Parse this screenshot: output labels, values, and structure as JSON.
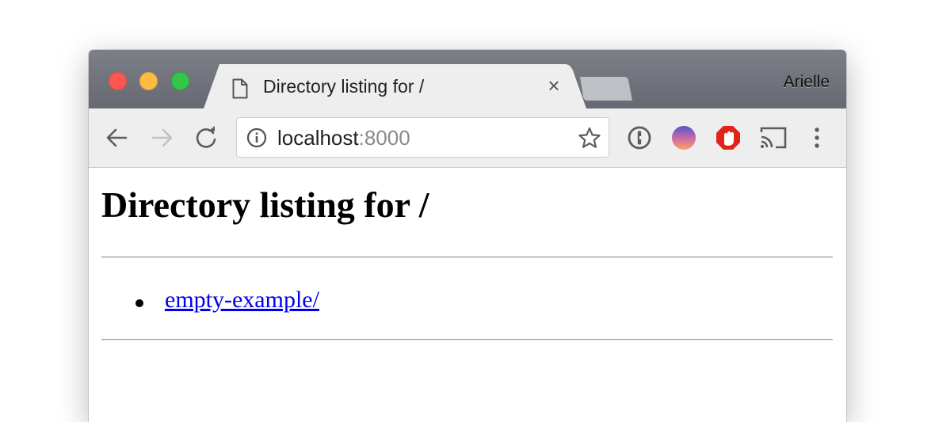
{
  "window": {
    "controls": [
      "close",
      "minimize",
      "zoom"
    ]
  },
  "tab": {
    "title": "Directory listing for /",
    "icon": "document-icon",
    "close_label": "×"
  },
  "profile": {
    "name": "Arielle"
  },
  "toolbar": {
    "back_icon": "back-arrow-icon",
    "forward_icon": "forward-arrow-icon",
    "reload_icon": "reload-icon",
    "url_host": "localhost",
    "url_port": ":8000",
    "info_icon": "info-icon",
    "bookmark_icon": "star-icon",
    "extensions": [
      "1password-icon",
      "gradient-extension-icon",
      "adblock-icon",
      "cast-icon",
      "more-menu-icon"
    ]
  },
  "page": {
    "heading": "Directory listing for /",
    "items": [
      {
        "label": "empty-example/"
      }
    ]
  },
  "colors": {
    "link": "#0000ee",
    "titlebar": "#6e7079",
    "toolbar": "#eeeeee"
  }
}
